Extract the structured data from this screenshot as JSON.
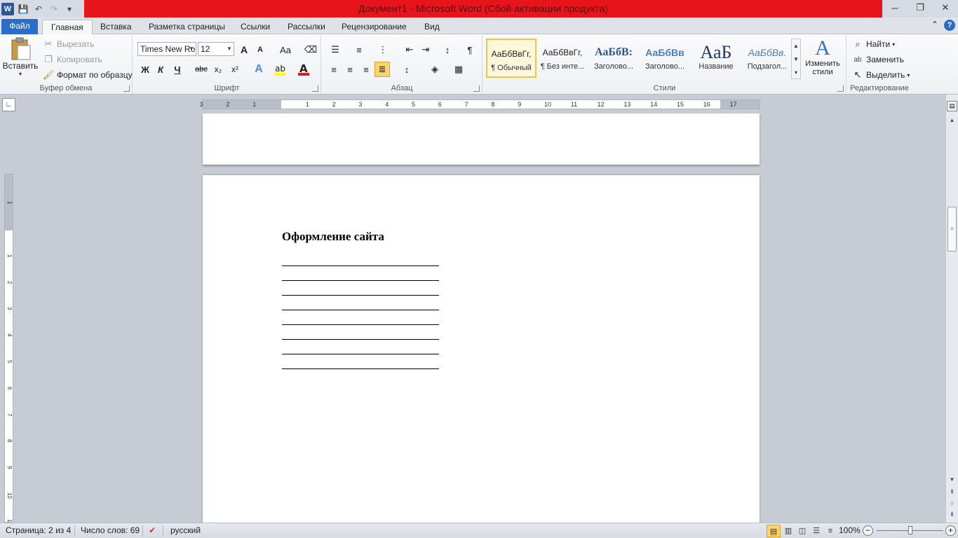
{
  "window": {
    "title": "Документ1 - Microsoft Word (Сбой активации продукта)",
    "logo_letter": "W",
    "controls": {
      "minimize": "─",
      "maximize": "❐",
      "close": "✕"
    }
  },
  "qat": {
    "save_icon": "💾",
    "undo_icon": "↶",
    "redo_icon": "↷",
    "customize_icon": "▾"
  },
  "tabs": [
    "Файл",
    "Главная",
    "Вставка",
    "Разметка страницы",
    "Ссылки",
    "Рассылки",
    "Рецензирование",
    "Вид"
  ],
  "clipboard": {
    "label": "Буфер обмена",
    "paste": "Вставить",
    "cut": "Вырезать",
    "copy": "Копировать",
    "format_painter": "Формат по образцу"
  },
  "font": {
    "label": "Шрифт",
    "name": "Times New Ro",
    "size": "12",
    "bold": "Ж",
    "italic": "К",
    "underline": "Ч",
    "strike": "abc",
    "subscript": "x₂",
    "superscript": "x²",
    "grow": "A",
    "shrink": "A",
    "case": "Aa"
  },
  "paragraph": {
    "label": "Абзац",
    "pilcrow": "¶"
  },
  "styles": {
    "label": "Стили",
    "items": [
      {
        "preview": "АаБбВвГг,",
        "name": "¶ Обычный"
      },
      {
        "preview": "АаБбВвГг,",
        "name": "¶ Без инте..."
      },
      {
        "preview": "АаБбВ:",
        "name": "Заголово..."
      },
      {
        "preview": "АаБбВв",
        "name": "Заголово..."
      },
      {
        "preview": "АаБ",
        "name": "Название"
      },
      {
        "preview": "АаБбВв.",
        "name": "Подзагол..."
      }
    ],
    "change": "Изменить стили"
  },
  "editing": {
    "label": "Редактирование",
    "find": "Найти",
    "replace": "Заменить",
    "select": "Выделить"
  },
  "ruler": {
    "h_numbers": [
      "3",
      "2",
      "1",
      "1",
      "2",
      "3",
      "4",
      "5",
      "6",
      "7",
      "8",
      "9",
      "10",
      "11",
      "12",
      "13",
      "14",
      "15",
      "16",
      "17"
    ],
    "v_numbers": [
      "1",
      "1",
      "2",
      "3",
      "4",
      "5",
      "6",
      "7",
      "8",
      "9",
      "10",
      "11"
    ]
  },
  "document": {
    "heading": "Оформление сайта",
    "line_count": 8
  },
  "status": {
    "page": "Страница: 2 из 4",
    "words": "Число слов: 69",
    "language": "русский",
    "zoom": "100%",
    "zoom_fraction": 0.5
  }
}
